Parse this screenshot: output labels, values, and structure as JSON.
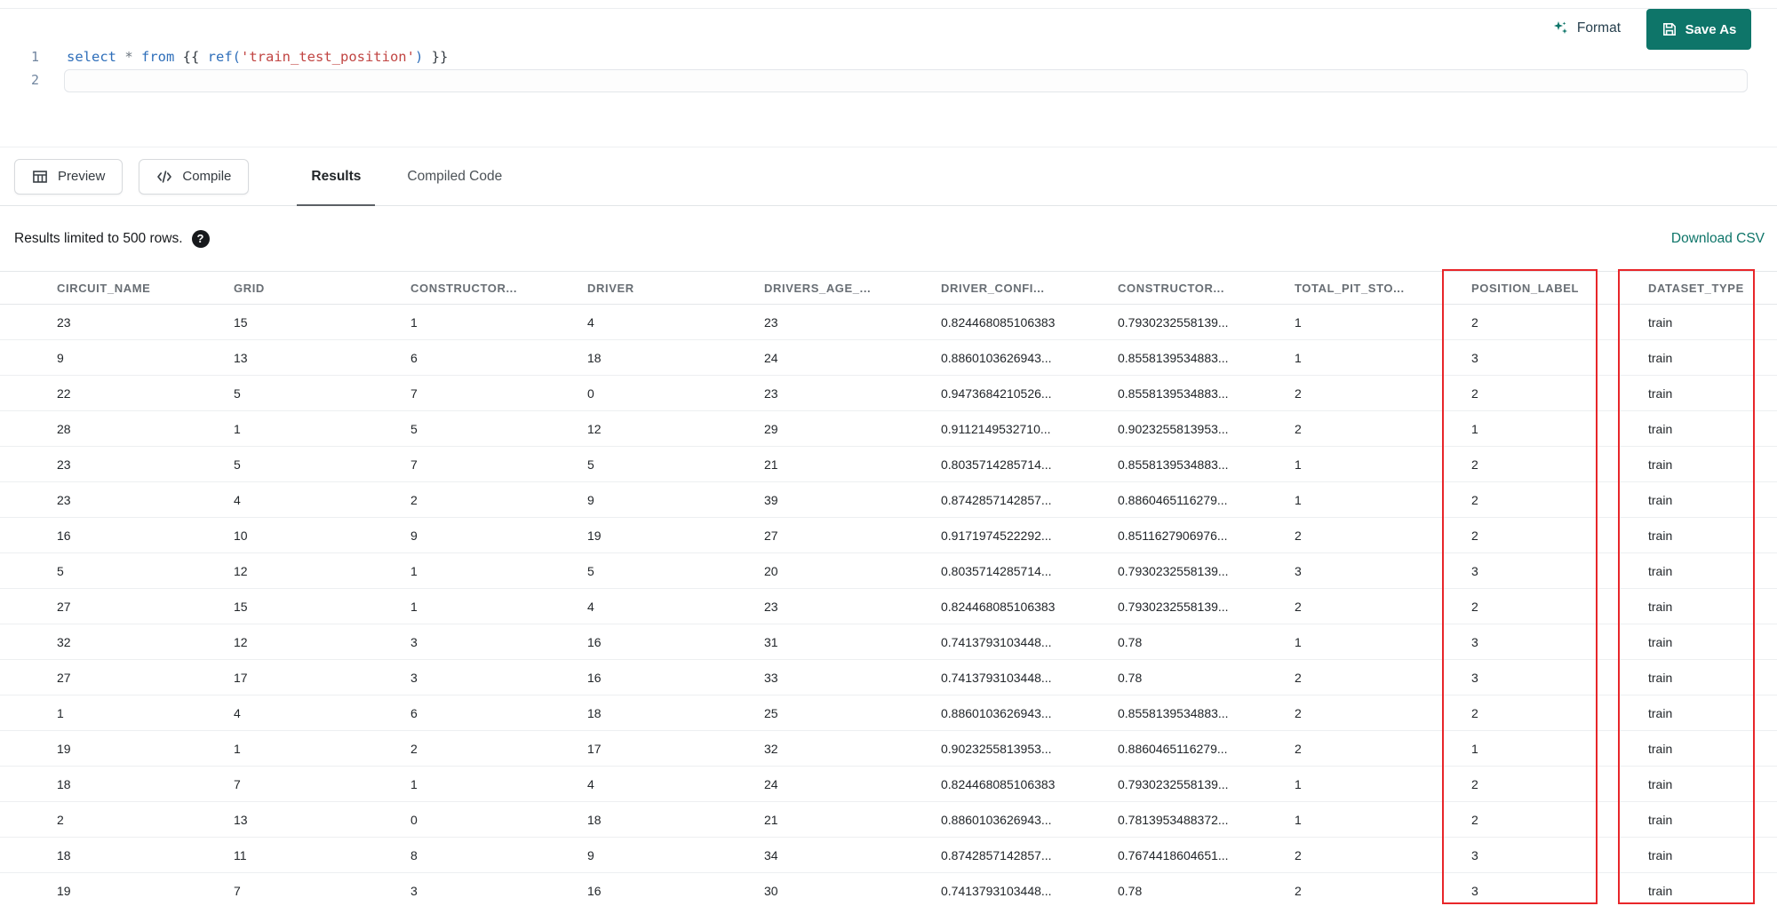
{
  "topbar": {
    "format_label": "Format",
    "save_as_label": "Save As"
  },
  "editor": {
    "line_numbers": [
      "1",
      "2"
    ],
    "code": {
      "kw_select": "select ",
      "star": "* ",
      "kw_from": "from ",
      "jinja_open": "{{ ",
      "fn_ref": "ref(",
      "str": "'train_test_position'",
      "paren_close": ")",
      "jinja_close": " }}"
    }
  },
  "toolbar": {
    "preview_label": "Preview",
    "compile_label": "Compile",
    "tabs": [
      {
        "label": "Results",
        "active": true
      },
      {
        "label": "Compiled Code",
        "active": false
      }
    ]
  },
  "results_bar": {
    "limit_text": "Results limited to 500 rows.",
    "help_label": "?",
    "download_csv_label": "Download CSV"
  },
  "table": {
    "columns": [
      "CIRCUIT_NAME",
      "GRID",
      "CONSTRUCTOR...",
      "DRIVER",
      "DRIVERS_AGE_...",
      "DRIVER_CONFI...",
      "CONSTRUCTOR...",
      "TOTAL_PIT_STO...",
      "POSITION_LABEL",
      "DATASET_TYPE"
    ],
    "rows": [
      [
        "23",
        "15",
        "1",
        "4",
        "23",
        "0.824468085106383",
        "0.7930232558139...",
        "1",
        "2",
        "train"
      ],
      [
        "9",
        "13",
        "6",
        "18",
        "24",
        "0.8860103626943...",
        "0.8558139534883...",
        "1",
        "3",
        "train"
      ],
      [
        "22",
        "5",
        "7",
        "0",
        "23",
        "0.9473684210526...",
        "0.8558139534883...",
        "2",
        "2",
        "train"
      ],
      [
        "28",
        "1",
        "5",
        "12",
        "29",
        "0.9112149532710...",
        "0.9023255813953...",
        "2",
        "1",
        "train"
      ],
      [
        "23",
        "5",
        "7",
        "5",
        "21",
        "0.8035714285714...",
        "0.8558139534883...",
        "1",
        "2",
        "train"
      ],
      [
        "23",
        "4",
        "2",
        "9",
        "39",
        "0.8742857142857...",
        "0.8860465116279...",
        "1",
        "2",
        "train"
      ],
      [
        "16",
        "10",
        "9",
        "19",
        "27",
        "0.9171974522292...",
        "0.8511627906976...",
        "2",
        "2",
        "train"
      ],
      [
        "5",
        "12",
        "1",
        "5",
        "20",
        "0.8035714285714...",
        "0.7930232558139...",
        "3",
        "3",
        "train"
      ],
      [
        "27",
        "15",
        "1",
        "4",
        "23",
        "0.824468085106383",
        "0.7930232558139...",
        "2",
        "2",
        "train"
      ],
      [
        "32",
        "12",
        "3",
        "16",
        "31",
        "0.7413793103448...",
        "0.78",
        "1",
        "3",
        "train"
      ],
      [
        "27",
        "17",
        "3",
        "16",
        "33",
        "0.7413793103448...",
        "0.78",
        "2",
        "3",
        "train"
      ],
      [
        "1",
        "4",
        "6",
        "18",
        "25",
        "0.8860103626943...",
        "0.8558139534883...",
        "2",
        "2",
        "train"
      ],
      [
        "19",
        "1",
        "2",
        "17",
        "32",
        "0.9023255813953...",
        "0.8860465116279...",
        "2",
        "1",
        "train"
      ],
      [
        "18",
        "7",
        "1",
        "4",
        "24",
        "0.824468085106383",
        "0.7930232558139...",
        "1",
        "2",
        "train"
      ],
      [
        "2",
        "13",
        "0",
        "18",
        "21",
        "0.8860103626943...",
        "0.7813953488372...",
        "1",
        "2",
        "train"
      ],
      [
        "18",
        "11",
        "8",
        "9",
        "34",
        "0.8742857142857...",
        "0.7674418604651...",
        "2",
        "3",
        "train"
      ],
      [
        "19",
        "7",
        "3",
        "16",
        "30",
        "0.7413793103448...",
        "0.78",
        "2",
        "3",
        "train"
      ]
    ],
    "annotations": {
      "highlighted_columns": [
        "POSITION_LABEL",
        "DATASET_TYPE"
      ],
      "highlight_color": "#e8262a"
    }
  },
  "colors": {
    "accent_teal": "#0e7569",
    "annotation_red": "#e8262a",
    "tab_underline": "#5b6065"
  }
}
